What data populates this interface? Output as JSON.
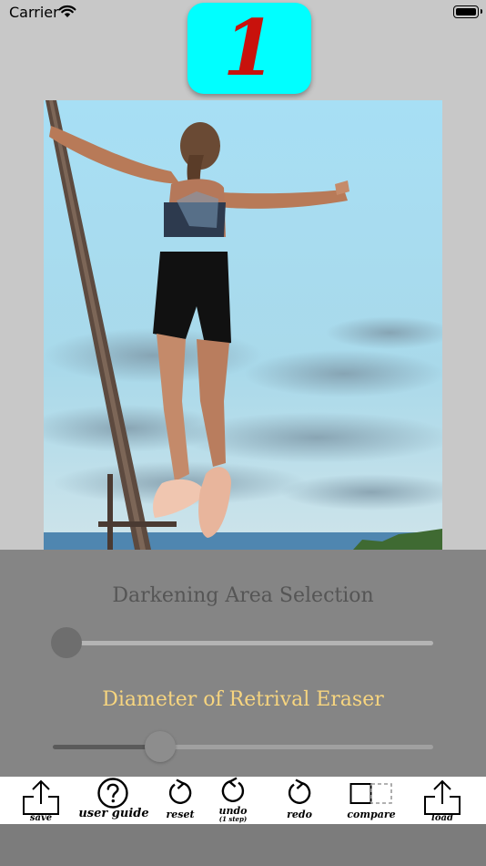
{
  "status_bar": {
    "carrier": "Carrier"
  },
  "app": {
    "logo_text": "1",
    "logo_color": "#00ffff",
    "logo_text_color": "#c8120c"
  },
  "photo": {
    "description_icon": "woman-on-pole-photo"
  },
  "panel": {
    "darkening_label": "Darkening Area Selection",
    "darkening_value": 0.0,
    "eraser_label": "Diameter of Retrival Eraser",
    "eraser_value": 0.28
  },
  "toolbar": {
    "save": "save",
    "user_guide": "user guide",
    "reset": "reset",
    "undo": "undo",
    "undo_sub": "(1 step)",
    "redo": "redo",
    "compare": "compare",
    "load": "load"
  }
}
